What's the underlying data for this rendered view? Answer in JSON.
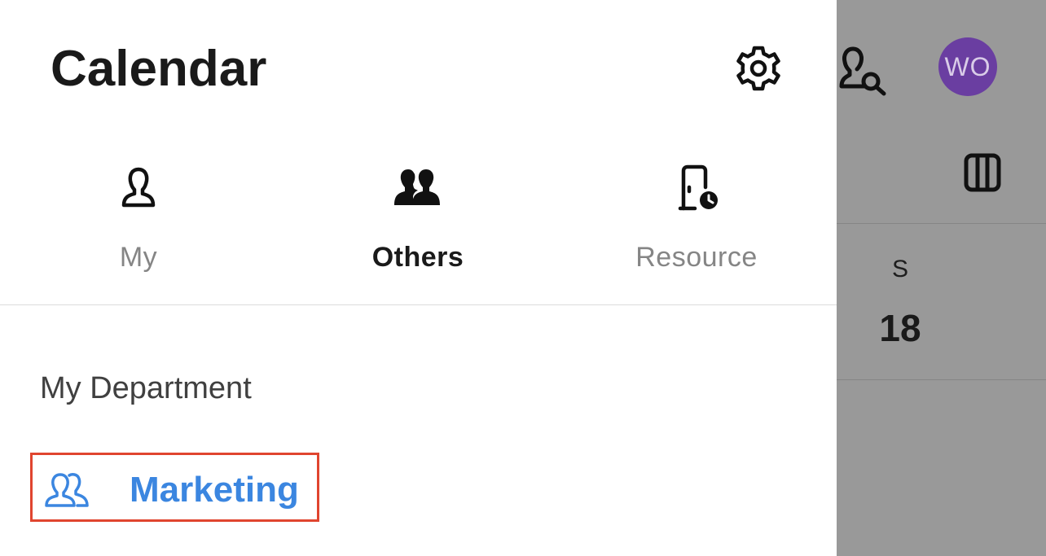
{
  "header": {
    "title": "Calendar",
    "settings_icon": "gear-icon",
    "search_icon": "person-search-icon"
  },
  "user": {
    "avatar_initials": "WO",
    "avatar_color": "#6a3ea1"
  },
  "tabs": [
    {
      "label": "My",
      "icon": "person-icon",
      "active": false
    },
    {
      "label": "Others",
      "icon": "people-icon",
      "active": true
    },
    {
      "label": "Resource",
      "icon": "door-clock-icon",
      "active": false
    }
  ],
  "section": {
    "title": "My Department"
  },
  "departments": [
    {
      "label": "Marketing",
      "icon": "group-icon",
      "color": "#3b86e0"
    }
  ],
  "background_calendar": {
    "view_icon": "columns-icon",
    "day_letter": "S",
    "day_number": "18"
  },
  "colors": {
    "accent": "#3b86e0",
    "highlight_border": "#e0452f",
    "overlay": "#999999"
  }
}
